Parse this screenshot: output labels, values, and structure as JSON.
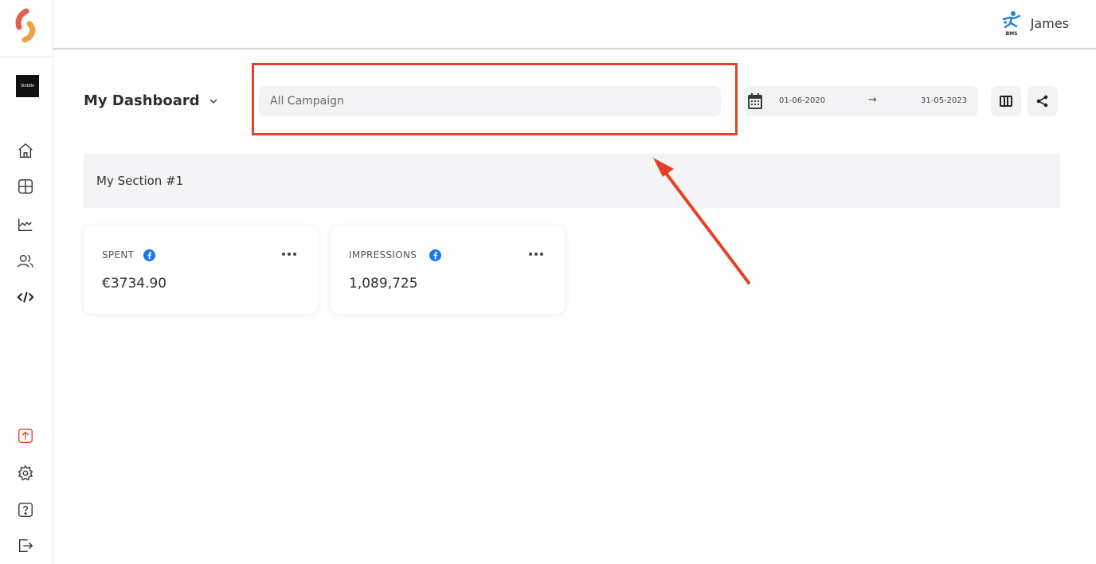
{
  "user": {
    "name": "James",
    "avatar_icon": "bms-logo-icon",
    "avatar_text": "BMS"
  },
  "sidebar": {
    "brand_text": "Stiddle",
    "items": [
      {
        "name": "home-icon"
      },
      {
        "name": "dashboard-grid-icon"
      },
      {
        "name": "chart-area-icon"
      },
      {
        "name": "users-icon"
      },
      {
        "name": "code-icon"
      },
      {
        "name": "upload-icon"
      },
      {
        "name": "gear-icon"
      },
      {
        "name": "help-icon"
      },
      {
        "name": "logout-icon"
      }
    ]
  },
  "header": {
    "title": "My Dashboard",
    "campaign_placeholder": "All Campaign",
    "date_start": "01-06-2020",
    "date_arrow": "→",
    "date_end": "31-05-2023"
  },
  "section": {
    "title": "My Section #1"
  },
  "cards": [
    {
      "label": "SPENT",
      "value": "€3734.90",
      "source_icon": "facebook-icon"
    },
    {
      "label": "IMPRESSIONS",
      "value": "1,089,725",
      "source_icon": "facebook-icon"
    }
  ],
  "colors": {
    "accent": "#e64027",
    "facebook": "#1877f2",
    "logo_orange": "#f08a3c",
    "logo_red": "#e85a4f"
  }
}
